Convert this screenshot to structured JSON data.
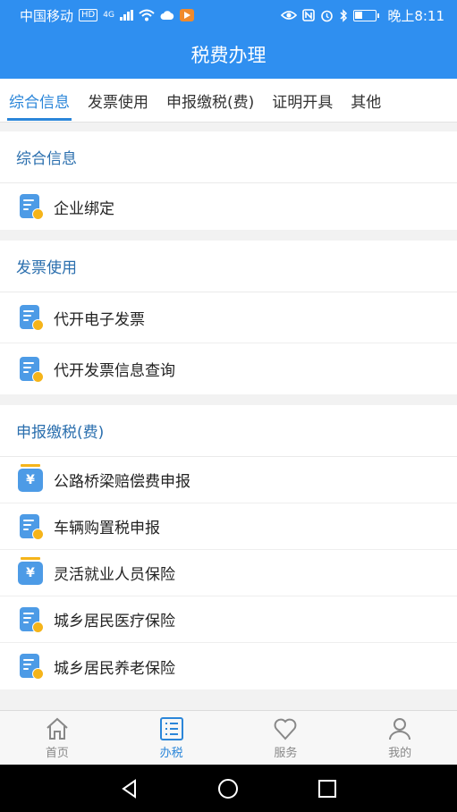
{
  "status_bar": {
    "carrier": "中国移动",
    "hd": "HD",
    "network": "4G",
    "time": "晚上8:11"
  },
  "header": {
    "title": "税费办理"
  },
  "tabs": [
    {
      "label": "综合信息",
      "active": true
    },
    {
      "label": "发票使用",
      "active": false
    },
    {
      "label": "申报缴税(费)",
      "active": false
    },
    {
      "label": "证明开具",
      "active": false
    },
    {
      "label": "其他",
      "active": false
    }
  ],
  "sections": [
    {
      "title": "综合信息",
      "items": [
        {
          "label": "企业绑定",
          "icon": "document-icon"
        }
      ]
    },
    {
      "title": "发票使用",
      "items": [
        {
          "label": "代开电子发票",
          "icon": "document-icon"
        },
        {
          "label": "代开发票信息查询",
          "icon": "document-icon"
        }
      ]
    },
    {
      "title": "申报缴税(费)",
      "items": [
        {
          "label": "公路桥梁赔偿费申报",
          "icon": "yen-icon"
        },
        {
          "label": "车辆购置税申报",
          "icon": "document-icon"
        },
        {
          "label": "灵活就业人员保险",
          "icon": "yen-icon"
        },
        {
          "label": "城乡居民医疗保险",
          "icon": "document-icon"
        },
        {
          "label": "城乡居民养老保险",
          "icon": "document-icon"
        }
      ]
    }
  ],
  "bottom_nav": [
    {
      "label": "首页",
      "icon": "home-icon",
      "active": false
    },
    {
      "label": "办税",
      "icon": "list-icon",
      "active": true
    },
    {
      "label": "服务",
      "icon": "heart-icon",
      "active": false
    },
    {
      "label": "我的",
      "icon": "user-icon",
      "active": false
    }
  ],
  "colors": {
    "primary": "#2f8ff0",
    "accent": "#2b86d9",
    "badge": "#f5b41a"
  }
}
